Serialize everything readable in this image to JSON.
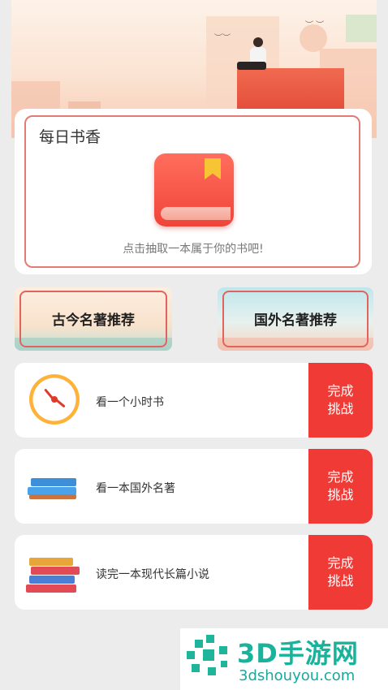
{
  "daily": {
    "title": "每日书香",
    "hint": "点击抽取一本属于你的书吧!"
  },
  "categories": [
    {
      "label": "古今名著推荐"
    },
    {
      "label": "国外名著推荐"
    }
  ],
  "tasks": [
    {
      "label": "看一个小时书",
      "button": [
        "完成",
        "挑战"
      ]
    },
    {
      "label": "看一本国外名著",
      "button": [
        "完成",
        "挑战"
      ]
    },
    {
      "label": "读完一本现代长篇小说",
      "button": [
        "完成",
        "挑战"
      ]
    }
  ],
  "watermark": {
    "brand": "3D手游网",
    "url": "3dshouyou.com"
  },
  "colors": {
    "accent": "#f03a36",
    "frame": "#e27b76",
    "watermark": "#18b39a"
  }
}
